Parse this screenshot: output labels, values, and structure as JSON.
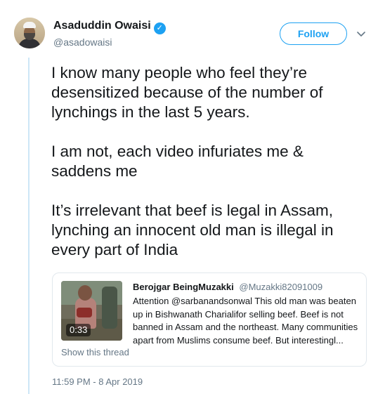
{
  "tweet": {
    "author_name": "Asaduddin Owaisi",
    "verified_icon": "✓",
    "author_handle": "@asadowaisi",
    "follow_label": "Follow",
    "paragraphs": [
      "I know many people who feel they’re desensitized because of the number of lynchings in the last 5 years.",
      "I am not, each video infuriates me & saddens me",
      "It’s irrelevant that beef is legal in Assam, lynching an innocent old man is illegal in every part of India"
    ],
    "timestamp": "11:59 PM - 8 Apr 2019"
  },
  "quoted": {
    "author_name": "Berojgar BeingMuzakki",
    "author_handle": "@Muzakki82091009",
    "text": "Attention @sarbanandsonwal This old man was beaten up in Bishwanath Charialifor selling beef. Beef is not banned in Assam and the northeast. Many communities apart from Muslims consume beef. But interestingl...",
    "video_duration": "0:33",
    "show_thread_label": "Show this thread"
  },
  "colors": {
    "accent": "#1da1f2",
    "secondary_text": "#657786",
    "thread_line": "#cde6f7",
    "border": "#e1e8ed"
  },
  "icons": {
    "verified": "verified-badge-icon",
    "more_menu": "chevron-down-icon"
  }
}
